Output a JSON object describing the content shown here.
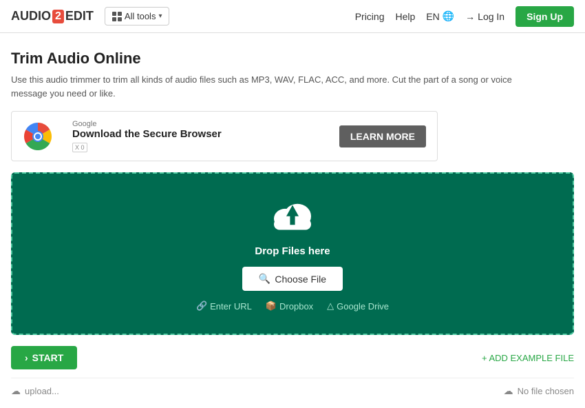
{
  "navbar": {
    "logo": {
      "audio": "AUDIO",
      "two": "2",
      "edit": "EDIT"
    },
    "all_tools_label": "All tools",
    "pricing_label": "Pricing",
    "help_label": "Help",
    "lang_label": "EN",
    "login_label": "Log In",
    "signup_label": "Sign Up"
  },
  "page": {
    "title": "Trim Audio Online",
    "description": "Use this audio trimmer to trim all kinds of audio files such as MP3, WAV, FLAC, ACC, and more. Cut the part of a song or voice message you need or like."
  },
  "ad": {
    "provider": "Google",
    "headline": "Download the Secure Browser",
    "cta": "LEARN MORE",
    "xo_label": "X 0"
  },
  "dropzone": {
    "drop_text": "Drop Files here",
    "choose_file_label": "Choose File",
    "search_icon": "🔍",
    "enter_url_label": "Enter URL",
    "dropbox_label": "Dropbox",
    "google_drive_label": "Google Drive"
  },
  "actions": {
    "start_label": "START",
    "add_example_label": "+ ADD EXAMPLE FILE"
  },
  "bottom": {
    "left_icon": "☁",
    "left_text": "upload...",
    "right_icon": "☁",
    "right_text": "No file chosen"
  }
}
